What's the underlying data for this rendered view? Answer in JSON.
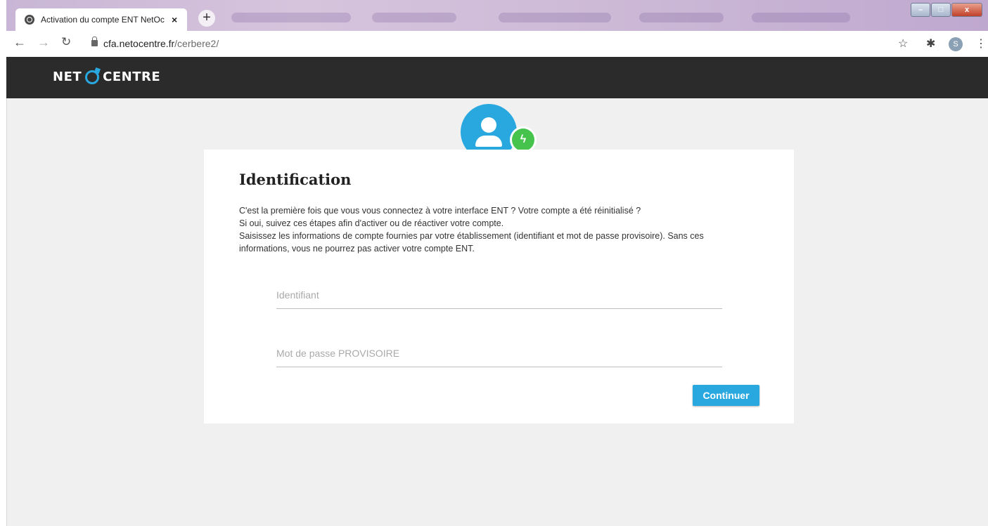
{
  "browser": {
    "tab_title": "Activation du compte ENT NetOc",
    "tab_close": "×",
    "new_tab": "+",
    "url_domain": "cfa.netocentre.fr",
    "url_path": "/cerbere2/",
    "profile_initial": "S",
    "window_buttons": {
      "minimize": "–",
      "maximize": "□",
      "close": "x"
    }
  },
  "site": {
    "logo_left": "NET",
    "logo_right": "CENTRE"
  },
  "card": {
    "title": "Identification",
    "description_lines": [
      "C'est la première fois que vous vous connectez à  votre interface ENT ? Votre compte a été réinitialisé ?",
      "Si oui, suivez ces étapes afin d'activer ou de réactiver votre compte.",
      "Saisissez les informations de compte fournies par votre établissement (identifiant et mot de passe provisoire). Sans ces",
      "informations, vous ne pourrez pas activer votre compte ENT."
    ],
    "identifiant_placeholder": "Identifiant",
    "password_placeholder": "Mot de passe PROVISOIRE",
    "submit_label": "Continuer"
  },
  "colors": {
    "accent": "#29a8e0",
    "bolt": "#46c34d",
    "header_bg": "#2b2b2b",
    "page_bg": "#f0f0f0"
  },
  "icons": [
    "globe-icon",
    "close-icon",
    "back-arrow-icon",
    "forward-arrow-icon",
    "reload-icon",
    "lock-icon",
    "star-icon",
    "extensions-icon",
    "menu-dots-icon",
    "user-avatar-icon",
    "lightning-bolt-icon"
  ]
}
